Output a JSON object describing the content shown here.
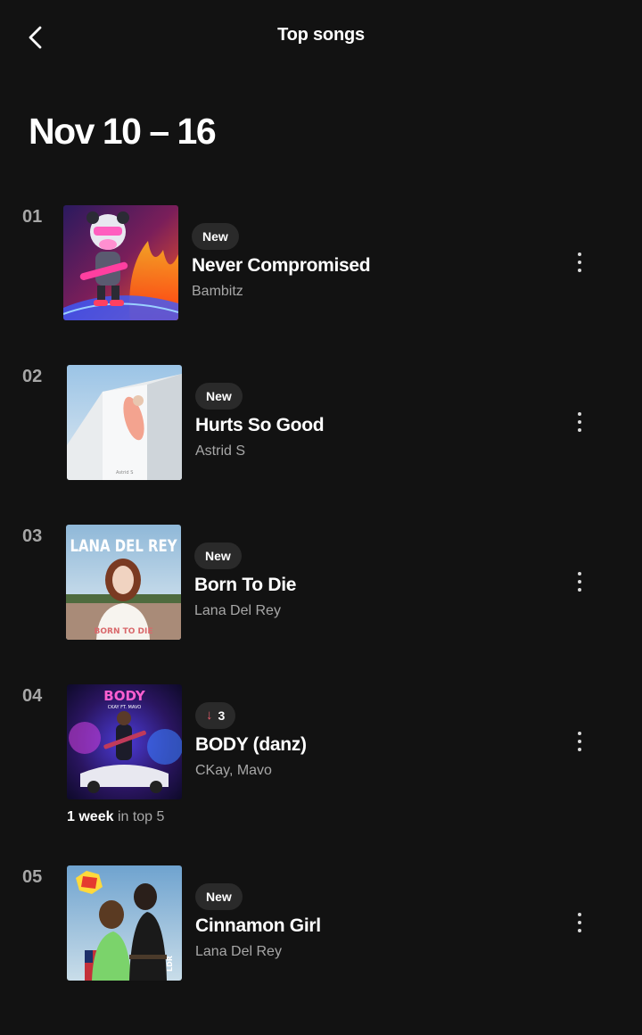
{
  "header": {
    "title": "Top songs",
    "back_icon": "chevron-left-icon"
  },
  "date_range": "Nov 10 – 16",
  "songs": [
    {
      "rank": "01",
      "badge": "New",
      "title": "Never Compromised",
      "artist": "Bambitz",
      "cover_icon": "album-art-panda-guitar"
    },
    {
      "rank": "02",
      "badge": "New",
      "title": "Hurts So Good",
      "artist": "Astrid S",
      "cover_icon": "album-art-astrid-s"
    },
    {
      "rank": "03",
      "badge": "New",
      "title": "Born To Die",
      "artist": "Lana Del Rey",
      "cover_icon": "album-art-lana-del-rey",
      "cover_text": "LANA DEL REY"
    },
    {
      "rank": "04",
      "badge_change": "3",
      "badge_direction": "down",
      "title": "BODY (danz)",
      "artist": "CKay, Mavo",
      "cover_icon": "album-art-body",
      "cover_text": "BODY",
      "weeks_count": "1 week",
      "weeks_suffix": "in top 5"
    },
    {
      "rank": "05",
      "badge": "New",
      "title": "Cinnamon Girl",
      "artist": "Lana Del Rey",
      "cover_icon": "album-art-nfr"
    }
  ],
  "colors": {
    "background": "#121212",
    "badge_bg": "#2a2a2a",
    "secondary_text": "#a7a7a7",
    "down_arrow": "#e35b6b"
  }
}
